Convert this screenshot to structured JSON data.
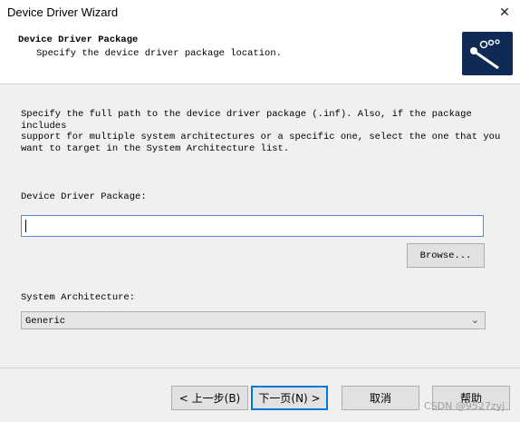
{
  "window": {
    "title": "Device Driver Wizard",
    "close_symbol": "✕"
  },
  "header": {
    "title": "Device Driver Package",
    "subtitle": "Specify the device driver package location.",
    "logo_icon": "driver-wizard-logo-icon"
  },
  "content": {
    "description": "Specify the full path to the device driver package (.inf). Also, if the package includes\nsupport for multiple system architectures or a specific one, select the one that you\nwant to target in the System Architecture list.",
    "package_label": "Device Driver Package:",
    "package_value": "",
    "browse_label": "Browse...",
    "arch_label": "System Architecture:",
    "arch_selected": "Generic"
  },
  "footer": {
    "back_label": "< 上一步(B)",
    "next_label": "下一页(N) >",
    "cancel_label": "取消",
    "help_label": "帮助"
  },
  "watermark": "CSDN @9527zyj",
  "colors": {
    "logo_bg": "#0e2a55",
    "focus_border": "#0078d7"
  }
}
